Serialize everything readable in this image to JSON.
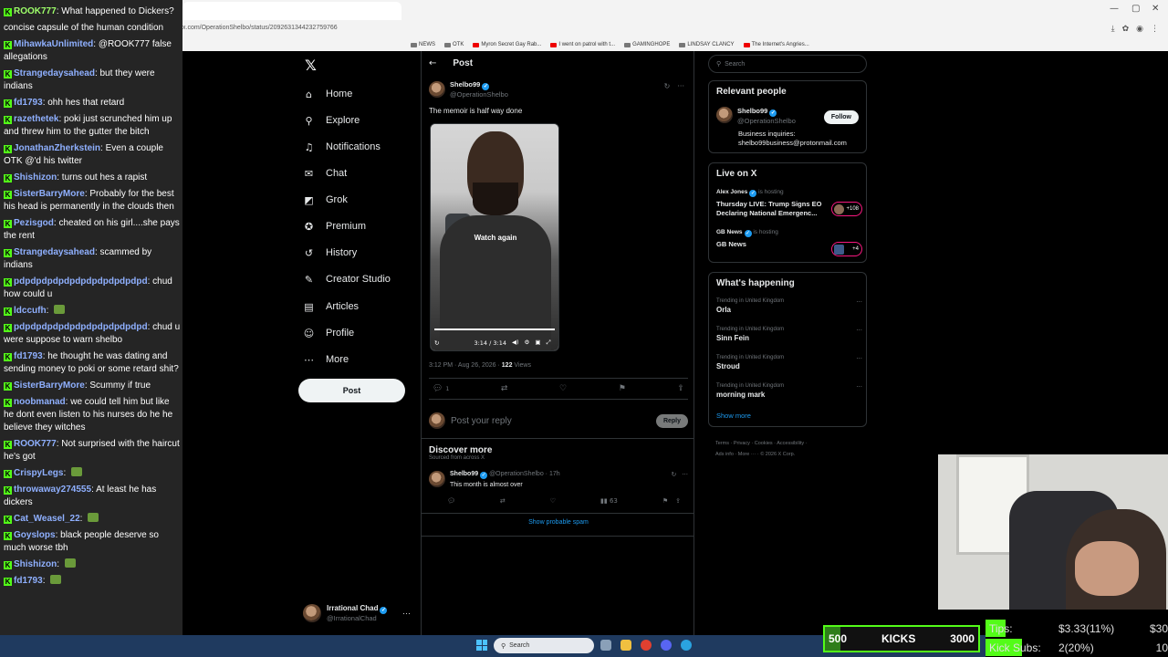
{
  "browser": {
    "url": "x.com/OperationShelbo/status/2092631344232759766",
    "bookmarks": [
      "NEWS",
      "OTK",
      "Myron Secret Gay Rab...",
      "I went on patrol with t...",
      "GAMINGHOPE",
      "LINDSAY CLANCY",
      "The Internet's Angries..."
    ],
    "window_controls": [
      "—",
      "▢",
      "✕"
    ]
  },
  "chat": {
    "messages": [
      {
        "user": "ROOK777",
        "text": "What happened to Dickers?",
        "color": "g"
      },
      {
        "user": "",
        "text": "concise capsule of the human condition",
        "color": ""
      },
      {
        "user": "MihawkaUnlimited",
        "text": "@ROOK777 false allegations",
        "color": "b"
      },
      {
        "user": "Strangedaysahead",
        "text": "but they were indians",
        "color": "b"
      },
      {
        "user": "fd1793",
        "text": "ohh hes that retard",
        "color": "b"
      },
      {
        "user": "razethetek",
        "text": "poki just scrunched him up and threw him to the gutter the bitch",
        "color": "b"
      },
      {
        "user": "JonathanZherkstein",
        "text": "Even a couple OTK @'d his twitter",
        "color": "b"
      },
      {
        "user": "Shishizon",
        "text": "turns out hes a rapist",
        "color": "b"
      },
      {
        "user": "SisterBarryMore",
        "text": "Probably for the best his head is permanently in the clouds then",
        "color": "b"
      },
      {
        "user": "Pezisgod",
        "text": "cheated on his girl....she pays the rent",
        "color": "b"
      },
      {
        "user": "Strangedaysahead",
        "text": "scammed by indians",
        "color": "b"
      },
      {
        "user": "pdpdpdpdpdpdpdpdpdpdpdpd",
        "text": "chud how could u",
        "color": "b"
      },
      {
        "user": "ldccufh",
        "text": "",
        "color": "b"
      },
      {
        "user": "pdpdpdpdpdpdpdpdpdpdpdpd",
        "text": "chud u were suppose to warn shelbo",
        "color": "b"
      },
      {
        "user": "fd1793",
        "text": "he thought he was dating and sending money to poki or some retard shit?",
        "color": "b"
      },
      {
        "user": "SisterBarryMore",
        "text": "Scummy if true",
        "color": "b"
      },
      {
        "user": "noobmanad",
        "text": "we could tell him but like he dont even listen to his nurses do he he believe they witches",
        "color": "b"
      },
      {
        "user": "ROOK777",
        "text": "Not surprised with the haircut he's got",
        "color": "b"
      },
      {
        "user": "CrispyLegs",
        "text": "",
        "color": "b"
      },
      {
        "user": "throwaway274555",
        "text": "At least he has dickers",
        "color": "b"
      },
      {
        "user": "Cat_Weasel_22",
        "text": "",
        "color": "b"
      },
      {
        "user": "Goyslops",
        "text": "black people deserve so much worse tbh",
        "color": "b"
      },
      {
        "user": "Shishizon",
        "text": "",
        "color": "b"
      },
      {
        "user": "fd1793",
        "text": "",
        "color": "b"
      }
    ]
  },
  "nav": {
    "items": [
      {
        "label": "Home",
        "icon": "⌂"
      },
      {
        "label": "Explore",
        "icon": "⚲"
      },
      {
        "label": "Notifications",
        "icon": "♫"
      },
      {
        "label": "Chat",
        "icon": "✉"
      },
      {
        "label": "Grok",
        "icon": "◩"
      },
      {
        "label": "Premium",
        "icon": "✪"
      },
      {
        "label": "History",
        "icon": "↺"
      },
      {
        "label": "Creator Studio",
        "icon": "✎"
      },
      {
        "label": "Articles",
        "icon": "▤"
      },
      {
        "label": "Profile",
        "icon": "☺"
      },
      {
        "label": "More",
        "icon": "⋯"
      }
    ],
    "post_label": "Post",
    "account": {
      "name": "Irrational Chad",
      "handle": "@IrrationalChad"
    }
  },
  "post": {
    "header_title": "Post",
    "author_name": "Shelbo99",
    "author_handle": "@OperationShelbo",
    "text": "The memoir is half way done",
    "video": {
      "overlay": "Watch again",
      "time": "3:14 / 3:14",
      "progress": 1.0
    },
    "timestamp": "3:12 PM · Aug 26, 2026 ·",
    "views_count": "122",
    "views_label": "Views",
    "reply_count": "1",
    "reply_placeholder": "Post your reply",
    "reply_button": "Reply"
  },
  "discover": {
    "title": "Discover more",
    "subtitle": "Sourced from across X",
    "post": {
      "name": "Shelbo99",
      "handle": "@OperationShelbo · 17h",
      "text": "This month is almost over",
      "views": "63"
    },
    "show_spam": "Show probable spam"
  },
  "sidebar": {
    "search_placeholder": "Search",
    "relevant": {
      "title": "Relevant people",
      "name": "Shelbo99",
      "handle": "@OperationShelbo",
      "follow": "Follow",
      "bio_line1": "Business inquiries:",
      "bio_line2": "shelbo99business@protonmail.com"
    },
    "live": {
      "title": "Live on X",
      "items": [
        {
          "host": "Alex Jones",
          "status": "is hosting",
          "title": "Thursday LIVE: Trump Signs EO Declaring National Emergenc...",
          "badge": "+108"
        },
        {
          "host": "GB News",
          "status": "is hosting",
          "title": "GB News",
          "badge": "+4"
        }
      ]
    },
    "happening": {
      "title": "What's happening",
      "trends": [
        {
          "context": "Trending in United Kingdom",
          "name": "Orla"
        },
        {
          "context": "Trending in United Kingdom",
          "name": "Sinn Fein"
        },
        {
          "context": "Trending in United Kingdom",
          "name": "Stroud"
        },
        {
          "context": "Trending in United Kingdom",
          "name": "morning mark"
        }
      ],
      "show_more": "Show more"
    },
    "footer_line1": "Terms  ·  Privacy  ·  Cookies  ·  Accessibility  ·",
    "footer_line2": "Ads info  ·  More ···  ·  © 2026 X Corp."
  },
  "taskbar": {
    "search": "Search"
  },
  "stream": {
    "kicks": {
      "start": "500",
      "label": "KICKS",
      "goal": "3000",
      "fraction": 0.1
    },
    "tips": {
      "label": "Tips:",
      "value": "$3.33(11%)",
      "goal": "$30",
      "fraction": 0.11
    },
    "subs": {
      "label": "Kick Subs:",
      "value": "2(20%)",
      "goal": "10",
      "fraction": 0.2
    }
  }
}
